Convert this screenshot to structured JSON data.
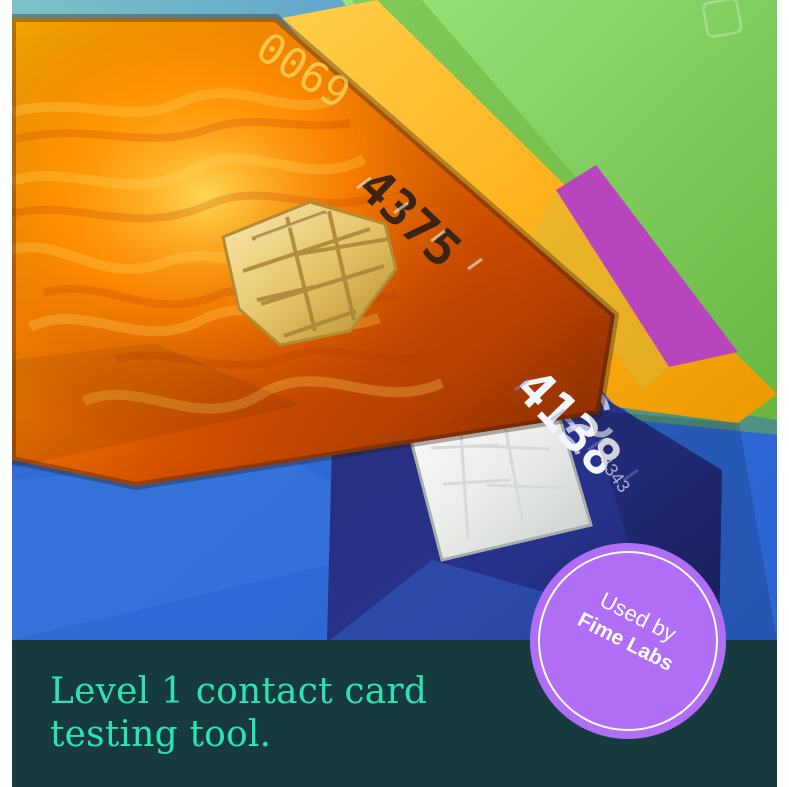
{
  "caption": {
    "line1": "Level 1 contact card",
    "line2": "testing tool."
  },
  "badge": {
    "line1": "Used by",
    "line2": "Fime Labs"
  },
  "photo_text": {
    "card1_number_fragment": "0069",
    "card1_number_fragment_2": "4375",
    "card2_number_fragment": "4138",
    "card2_number_fragment_2": "4343"
  },
  "colors": {
    "panel": "#173a3e",
    "caption": "#2ce2b6",
    "badge": "#b06ef6",
    "badge_text": "#ffffff"
  }
}
